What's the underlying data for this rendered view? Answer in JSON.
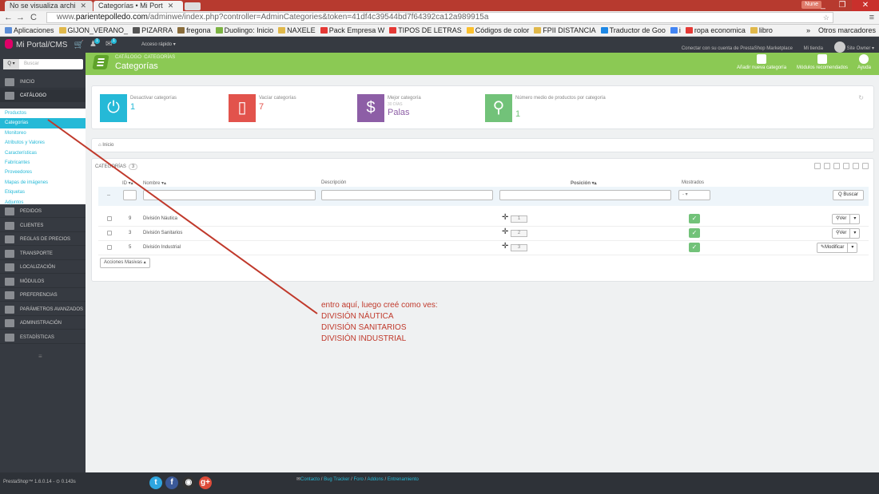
{
  "browser": {
    "tabs": [
      {
        "label": "No se visualiza archi"
      },
      {
        "label": "Categorías • Mi Port"
      }
    ],
    "user_chip": "Nune",
    "url_prefix": "www.",
    "url_host": "parientepolledo.com",
    "url_path": "/adminwe/index.php?controller=AdminCategories&token=41df4c39544bd7f64392ca12a989915a",
    "bookmarks": [
      "Aplicaciones",
      "GIJON_VERANO_",
      "PIZARRA",
      "fregona",
      "Duolingo: Inicio",
      "NAXELE",
      "Pack Empresa W",
      "TIPOS DE LETRAS",
      "Códigos de color",
      "FPII DISTANCIA",
      "Traductor de Goo",
      "i",
      "ropa economica",
      "libro"
    ],
    "bookmarks_more": "»",
    "other_bookmarks": "Otros marcadores",
    "bookmark_colors": [
      "#5b8dd6",
      "#e0b84a",
      "#555",
      "#8a6d3b",
      "#7cb342",
      "#e0b84a",
      "#e53935",
      "#e53935",
      "#fbc02d",
      "#e0b84a",
      "#1e88e5",
      "#4285f4",
      "#e53935",
      "#e0b84a"
    ]
  },
  "header": {
    "shop_name": "Mi Portal/CMS",
    "badge_orders": "1",
    "badge_messages": "1",
    "quick_access": "Acceso rápido ▾",
    "marketplace": "Conectar con su cuenta de PrestaShop Marketplace",
    "my_shop": "Mi tienda",
    "owner": "Site Owner ▾"
  },
  "sidebar": {
    "search_btn": "Q ▾",
    "search_placeholder": "Buscar",
    "top_items": [
      {
        "label": "Inicio",
        "icon": "dashboard-icon"
      },
      {
        "label": "Catálogo",
        "icon": "catalog-icon"
      }
    ],
    "catalog_sub": [
      "Productos",
      "Categorías",
      "Monitoreo",
      "Atributos y Valores",
      "Características",
      "Fabricantes",
      "Proveedores",
      "Mapas de imágenes",
      "Etiquetas",
      "Adjuntos"
    ],
    "items": [
      {
        "label": "Pedidos",
        "icon": "orders-icon"
      },
      {
        "label": "Clientes",
        "icon": "customers-icon"
      },
      {
        "label": "Reglas de precios",
        "icon": "price-rules-icon"
      },
      {
        "label": "Transporte",
        "icon": "shipping-icon"
      },
      {
        "label": "Localización",
        "icon": "localization-icon"
      },
      {
        "label": "Módulos",
        "icon": "modules-icon"
      },
      {
        "label": "Preferencias",
        "icon": "preferences-icon"
      },
      {
        "label": "Parámetros Avanzados",
        "icon": "advanced-icon"
      },
      {
        "label": "Administración",
        "icon": "admin-icon"
      },
      {
        "label": "Estadísticas",
        "icon": "stats-icon"
      }
    ],
    "collapse": "≡"
  },
  "toolbar": {
    "breadcrumb_1": "Catálogo",
    "breadcrumb_2": "Categorías",
    "title": "Categorías",
    "btn_add": "Añadir nueva categoría",
    "btn_modules": "Módulos recomendados",
    "btn_help": "Ayuda"
  },
  "kpis": [
    {
      "label": "Desactivar categorías",
      "sub": "",
      "value": "1",
      "color": "#25b9d7",
      "glyph": "⏻"
    },
    {
      "label": "Vacíar categorías",
      "sub": "",
      "value": "7",
      "color": "#e2534c",
      "glyph": "▯"
    },
    {
      "label": "Mejor categoría",
      "sub": "30 DÍAS",
      "value": "Palas",
      "color": "#8d5ea6",
      "glyph": "$"
    },
    {
      "label": "Número medio de productos por categoría",
      "sub": "",
      "value": "1",
      "color": "#72c279",
      "glyph": "⚲"
    }
  ],
  "breadcrumb": "Inicio",
  "list": {
    "title": "Categorías",
    "count": "3",
    "col_id": "ID ▾▴",
    "col_name": "Nombre ▾▴",
    "col_desc": "Descripción",
    "col_pos": "Posición ▾▴",
    "col_shown": "Mostrados",
    "filter_dash": "--",
    "filter_select": "- ▾",
    "search_btn": "Q Buscar",
    "rows": [
      {
        "id": "9",
        "name": "División Náutica",
        "position": "1",
        "action": "Ver"
      },
      {
        "id": "3",
        "name": "División Sanitarios",
        "position": "2",
        "action": "Ver"
      },
      {
        "id": "5",
        "name": "División Industrial",
        "position": "3",
        "action": "Modificar"
      }
    ],
    "bulk": "Acciones Masivas ▴"
  },
  "annotation": {
    "line1": "entro aquí, luego creé como ves:",
    "line2": "DIVISIÓN NÁUTICA",
    "line3": "DIVISIÓN SANITARIOS",
    "line4": "DIVISIÓN INDUSTRIAL",
    "color": "#c0392b"
  },
  "footer": {
    "version": "PrestaShop™ 1.6.0.14 - ⊙ 0.143s",
    "contact": "Contacto",
    "bug": "Bug Tracker",
    "forum": "Foro",
    "addons": "Addons",
    "training": "Entrenamiento",
    "sep": " / "
  }
}
